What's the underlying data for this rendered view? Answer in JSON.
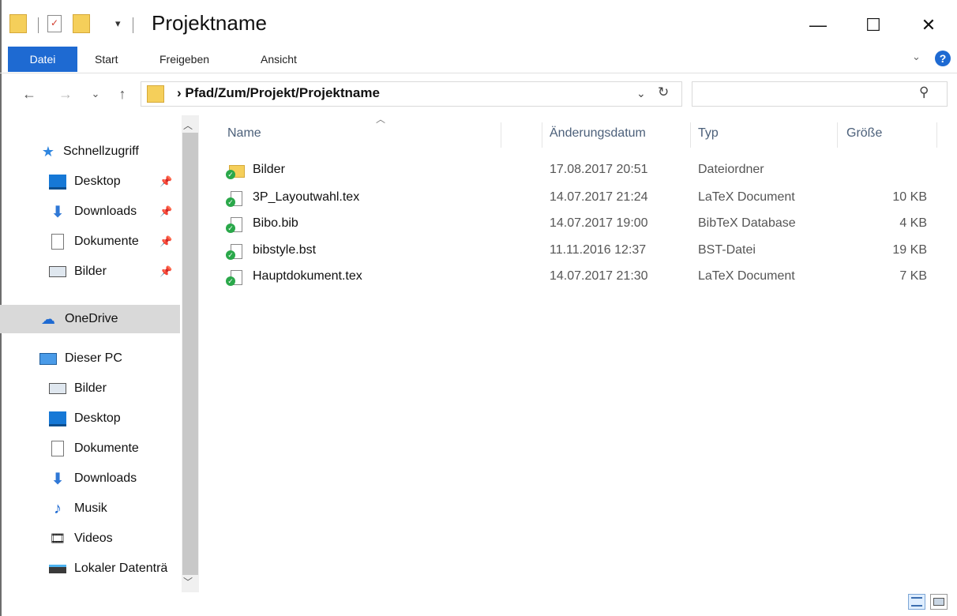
{
  "window": {
    "title": "Projektname",
    "minimize": "—",
    "maximize": "☐",
    "close": "✕"
  },
  "ribbon": {
    "tabs": [
      "Datei",
      "Start",
      "Freigeben",
      "Ansicht"
    ],
    "help": "?",
    "expand": "⌄"
  },
  "navbar": {
    "path": "› Pfad/Zum/Projekt/Projektname",
    "back": "←",
    "forward": "→",
    "recent": "⌄",
    "up": "↑",
    "dropdown": "⌄",
    "refresh": "↻",
    "search_icon": "⚲",
    "search_placeholder": ""
  },
  "sidebar": {
    "quick_access": {
      "label": "Schnellzugriff",
      "items": [
        {
          "label": "Desktop",
          "icon": "desktop-icon",
          "pin": "📌"
        },
        {
          "label": "Downloads",
          "icon": "downloads-icon",
          "pin": "📌"
        },
        {
          "label": "Dokumente",
          "icon": "documents-icon",
          "pin": "📌"
        },
        {
          "label": "Bilder",
          "icon": "pictures-icon",
          "pin": "📌"
        }
      ]
    },
    "onedrive": {
      "label": "OneDrive"
    },
    "this_pc": {
      "label": "Dieser PC",
      "items": [
        {
          "label": "Bilder",
          "icon": "pictures-icon"
        },
        {
          "label": "Desktop",
          "icon": "desktop-icon"
        },
        {
          "label": "Dokumente",
          "icon": "documents-icon"
        },
        {
          "label": "Downloads",
          "icon": "downloads-icon"
        },
        {
          "label": "Musik",
          "icon": "music-icon"
        },
        {
          "label": "Videos",
          "icon": "videos-icon"
        },
        {
          "label": "Lokaler Datenträ",
          "icon": "local-disk-icon"
        }
      ]
    }
  },
  "columns": {
    "name": "Name",
    "date": "Änderungsdatum",
    "type": "Typ",
    "size": "Größe"
  },
  "files": [
    {
      "name": "Bilder",
      "date": "17.08.2017 20:51",
      "type": "Dateiordner",
      "size": "",
      "icon": "folder-icon"
    },
    {
      "name": "3P_Layoutwahl.tex",
      "date": "14.07.2017 21:24",
      "type": "LaTeX Document",
      "size": "10 KB",
      "icon": "tex-file-icon"
    },
    {
      "name": "Bibo.bib",
      "date": "14.07.2017 19:00",
      "type": "BibTeX Database",
      "size": "4 KB",
      "icon": "bib-file-icon"
    },
    {
      "name": "bibstyle.bst",
      "date": "11.11.2016 12:37",
      "type": "BST-Datei",
      "size": "19 KB",
      "icon": "file-icon"
    },
    {
      "name": "Hauptdokument.tex",
      "date": "14.07.2017 21:30",
      "type": "LaTeX Document",
      "size": "7 KB",
      "icon": "tex-file-icon"
    }
  ],
  "colors": {
    "accent": "#1e6ad2",
    "folder": "#f5cf5a",
    "sync_badge": "#2aa84a",
    "selected": "#d9d9d9"
  }
}
